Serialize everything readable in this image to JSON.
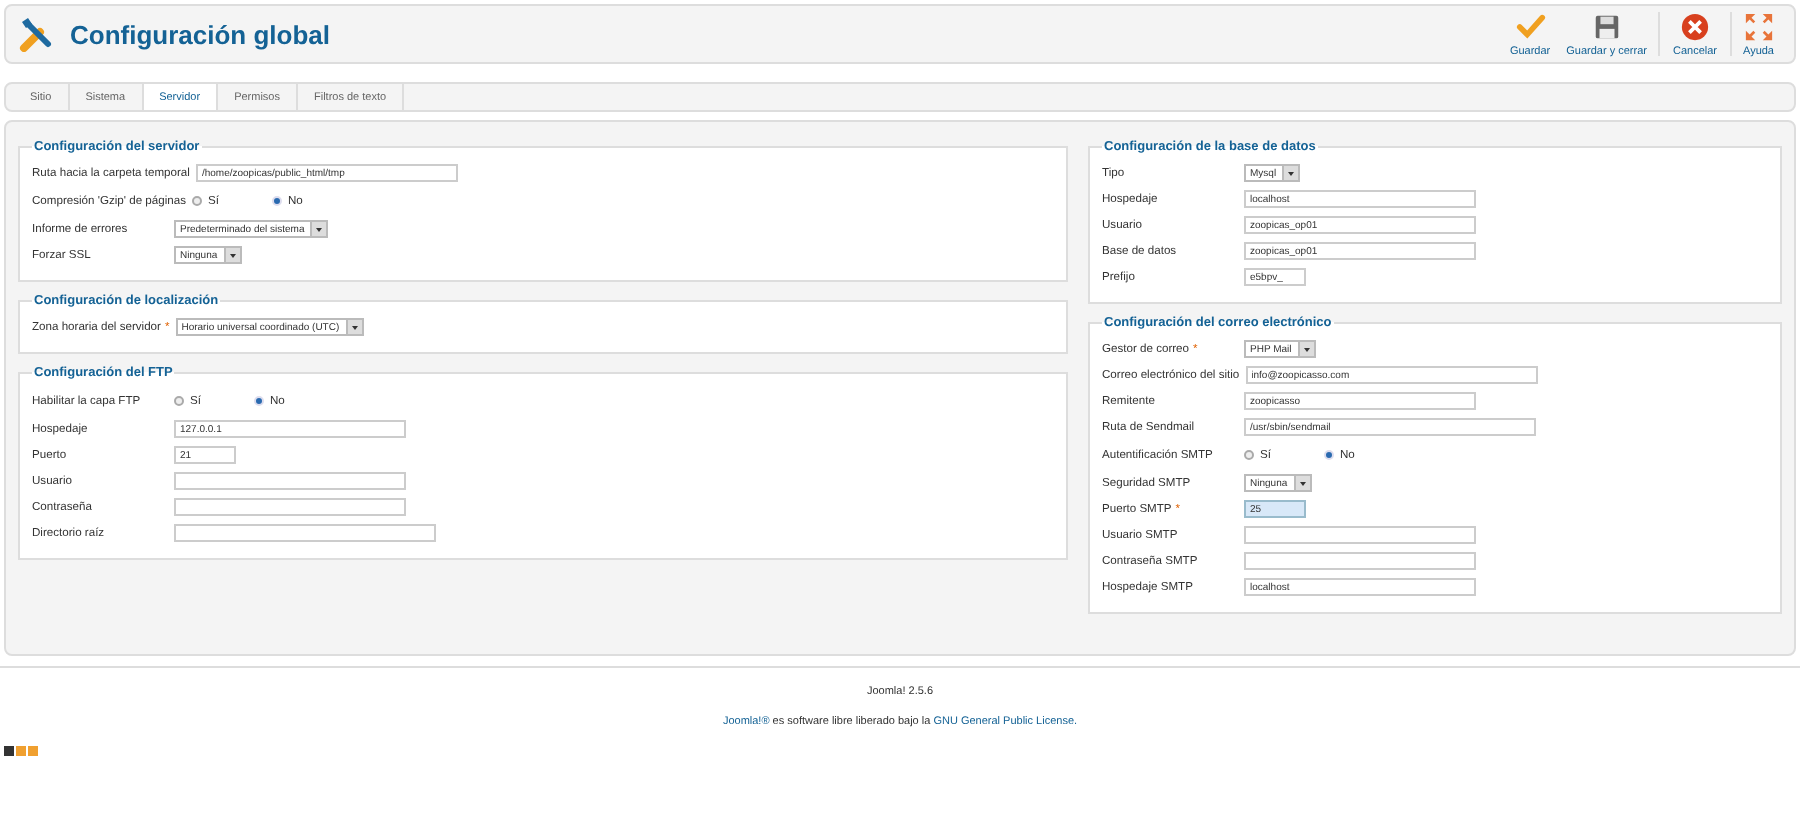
{
  "header": {
    "title": "Configuración global"
  },
  "toolbar": [
    {
      "kind": "save",
      "label": "Guardar"
    },
    {
      "kind": "save-close",
      "label": "Guardar y cerrar"
    },
    {
      "kind": "cancel",
      "label": "Cancelar"
    },
    {
      "kind": "help",
      "label": "Ayuda"
    }
  ],
  "tabs": [
    {
      "label": "Sitio",
      "selected": false
    },
    {
      "label": "Sistema",
      "selected": false
    },
    {
      "label": "Servidor",
      "selected": true
    },
    {
      "label": "Permisos",
      "selected": false
    },
    {
      "label": "Filtros de texto",
      "selected": false
    }
  ],
  "left_column": [
    {
      "title": "Configuración del servidor",
      "fields": [
        {
          "kind": "path",
          "label": "Ruta hacia la carpeta temporal",
          "value": "/home/zoopicas/public_html/tmp",
          "focused": false
        },
        {
          "kind": "radio",
          "label": "Compresión 'Gzip' de páginas",
          "options": [
            {
              "label": "Sí",
              "selected": false
            },
            {
              "label": "No",
              "selected": true
            }
          ]
        },
        {
          "kind": "select",
          "label": "Informe de errores",
          "value": "Predeterminado del sistema"
        },
        {
          "kind": "select",
          "label": "Forzar SSL",
          "value": "Ninguna"
        }
      ]
    },
    {
      "title": "Configuración de localización",
      "fields": [
        {
          "kind": "select",
          "label": "Zona horaria del servidor",
          "required_mark": "*",
          "value": "Horario universal coordinado (UTC)"
        }
      ]
    },
    {
      "title": "Configuración del FTP",
      "fields": [
        {
          "kind": "radio",
          "label": "Habilitar la capa FTP",
          "options": [
            {
              "label": "Sí",
              "selected": false
            },
            {
              "label": "No",
              "selected": true
            }
          ]
        },
        {
          "kind": "text",
          "label": "Hospedaje",
          "value": "127.0.0.1",
          "focused": false
        },
        {
          "kind": "short",
          "label": "Puerto",
          "value": "21",
          "focused": false
        },
        {
          "kind": "text",
          "label": "Usuario",
          "focused": false
        },
        {
          "kind": "text",
          "label": "Contraseña",
          "focused": false
        },
        {
          "kind": "path",
          "label": "Directorio raíz",
          "focused": false
        }
      ]
    }
  ],
  "right_column": [
    {
      "title": "Configuración de la base de datos",
      "fields": [
        {
          "kind": "select",
          "label": "Tipo",
          "value": "Mysql"
        },
        {
          "kind": "text",
          "label": "Hospedaje",
          "value": "localhost",
          "focused": false
        },
        {
          "kind": "text",
          "label": "Usuario",
          "value": "zoopicas_op01",
          "focused": false
        },
        {
          "kind": "text",
          "label": "Base de datos",
          "value": "zoopicas_op01",
          "focused": false
        },
        {
          "kind": "short",
          "label": "Prefijo",
          "value": "e5bpv_",
          "focused": false
        }
      ]
    },
    {
      "title": "Configuración del correo electrónico",
      "fields": [
        {
          "kind": "select",
          "label": "Gestor de correo",
          "required_mark": "*",
          "value": "PHP Mail"
        },
        {
          "kind": "text",
          "label": "Correo electrónico del sitio",
          "value": "info@zoopicasso.com",
          "focused": false
        },
        {
          "kind": "text",
          "label": "Remitente",
          "value": "zoopicasso",
          "focused": false
        },
        {
          "kind": "text",
          "label": "Ruta de Sendmail",
          "value": "/usr/sbin/sendmail",
          "focused": false
        },
        {
          "kind": "radio",
          "label": "Autentificación SMTP",
          "options": [
            {
              "label": "Sí",
              "selected": false
            },
            {
              "label": "No",
              "selected": true
            }
          ]
        },
        {
          "kind": "select",
          "label": "Seguridad SMTP",
          "value": "Ninguna"
        },
        {
          "kind": "short",
          "label": "Puerto SMTP",
          "required_mark": "*",
          "value": "25",
          "focused": true
        },
        {
          "kind": "text",
          "label": "Usuario SMTP",
          "focused": false
        },
        {
          "kind": "text",
          "label": "Contraseña SMTP",
          "focused": false
        },
        {
          "kind": "text",
          "label": "Hospedaje SMTP",
          "value": "localhost",
          "focused": false
        }
      ]
    }
  ],
  "footer": {
    "version": "Joomla! 2.5.6",
    "license_link_1": "Joomla!®",
    "license_text": "es software libre liberado bajo la",
    "license_link_2": "GNU General Public License."
  }
}
